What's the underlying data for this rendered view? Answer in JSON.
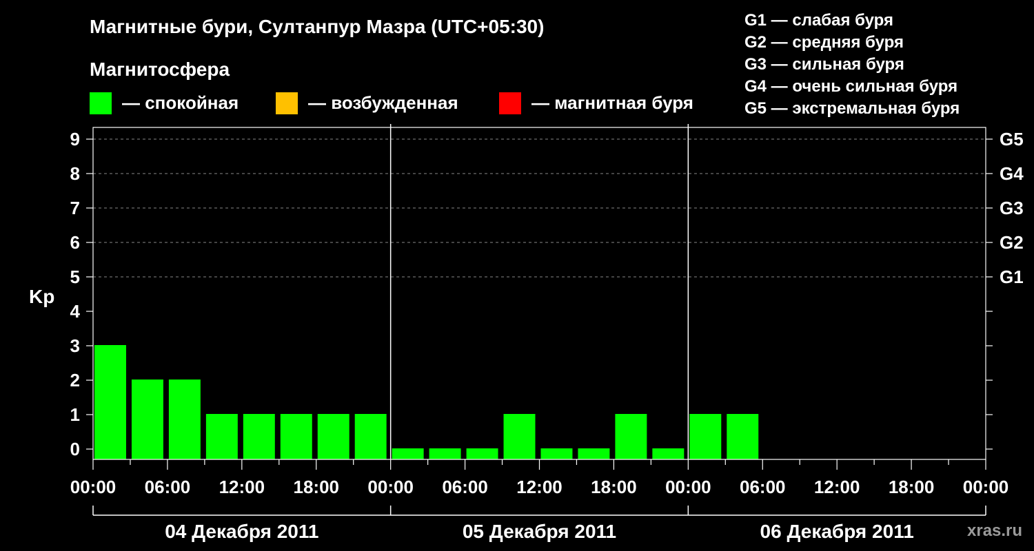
{
  "chart_data": {
    "type": "bar",
    "title": "Магнитные бури, Султанпур Мазра (UTC+05:30)",
    "subtitle": "Магнитосфера",
    "ylabel": "Kp",
    "ylim": [
      0,
      9
    ],
    "y_ticks": [
      "0",
      "1",
      "2",
      "3",
      "4",
      "5",
      "6",
      "7",
      "8",
      "9"
    ],
    "right_ticks": [
      {
        "kp": 5,
        "label": "G1"
      },
      {
        "kp": 6,
        "label": "G2"
      },
      {
        "kp": 7,
        "label": "G3"
      },
      {
        "kp": 8,
        "label": "G4"
      },
      {
        "kp": 9,
        "label": "G5"
      }
    ],
    "grid": "dashed horizontal at Kp 5-9",
    "x_range_hours": [
      0,
      72
    ],
    "x_ticks": [
      "00:00",
      "06:00",
      "12:00",
      "18:00",
      "00:00",
      "06:00",
      "12:00",
      "18:00",
      "00:00",
      "06:00",
      "12:00",
      "18:00",
      "00:00"
    ],
    "days": [
      "04 Декабря 2011",
      "05 Декабря 2011",
      "06 Декабря 2011"
    ],
    "bars": [
      {
        "start_hour": 0,
        "value": 3,
        "status": "quiet"
      },
      {
        "start_hour": 3,
        "value": 2,
        "status": "quiet"
      },
      {
        "start_hour": 6,
        "value": 2,
        "status": "quiet"
      },
      {
        "start_hour": 9,
        "value": 1,
        "status": "quiet"
      },
      {
        "start_hour": 12,
        "value": 1,
        "status": "quiet"
      },
      {
        "start_hour": 15,
        "value": 1,
        "status": "quiet"
      },
      {
        "start_hour": 18,
        "value": 1,
        "status": "quiet"
      },
      {
        "start_hour": 21,
        "value": 1,
        "status": "quiet"
      },
      {
        "start_hour": 24,
        "value": 0,
        "status": "quiet"
      },
      {
        "start_hour": 27,
        "value": 0,
        "status": "quiet"
      },
      {
        "start_hour": 30,
        "value": 0,
        "status": "quiet"
      },
      {
        "start_hour": 33,
        "value": 1,
        "status": "quiet"
      },
      {
        "start_hour": 36,
        "value": 0,
        "status": "quiet"
      },
      {
        "start_hour": 39,
        "value": 0,
        "status": "quiet"
      },
      {
        "start_hour": 42,
        "value": 1,
        "status": "quiet"
      },
      {
        "start_hour": 45,
        "value": 0,
        "status": "quiet"
      },
      {
        "start_hour": 48,
        "value": 1,
        "status": "quiet"
      },
      {
        "start_hour": 51,
        "value": 1,
        "status": "quiet"
      }
    ],
    "legend": [
      {
        "key": "quiet",
        "label": "— спокойная",
        "color": "#00ff00"
      },
      {
        "key": "excited",
        "label": "— возбужденная",
        "color": "#ffc000"
      },
      {
        "key": "storm",
        "label": "— магнитная буря",
        "color": "#ff0000"
      }
    ],
    "g_legend": [
      "G1 — слабая буря",
      "G2 — средняя буря",
      "G3 — сильная буря",
      "G4 — очень сильная буря",
      "G5 — экстремальная буря"
    ],
    "colors": {
      "background": "#000000",
      "axis": "#ffffff",
      "grid": "#888888"
    }
  },
  "watermark": "xras.ru"
}
